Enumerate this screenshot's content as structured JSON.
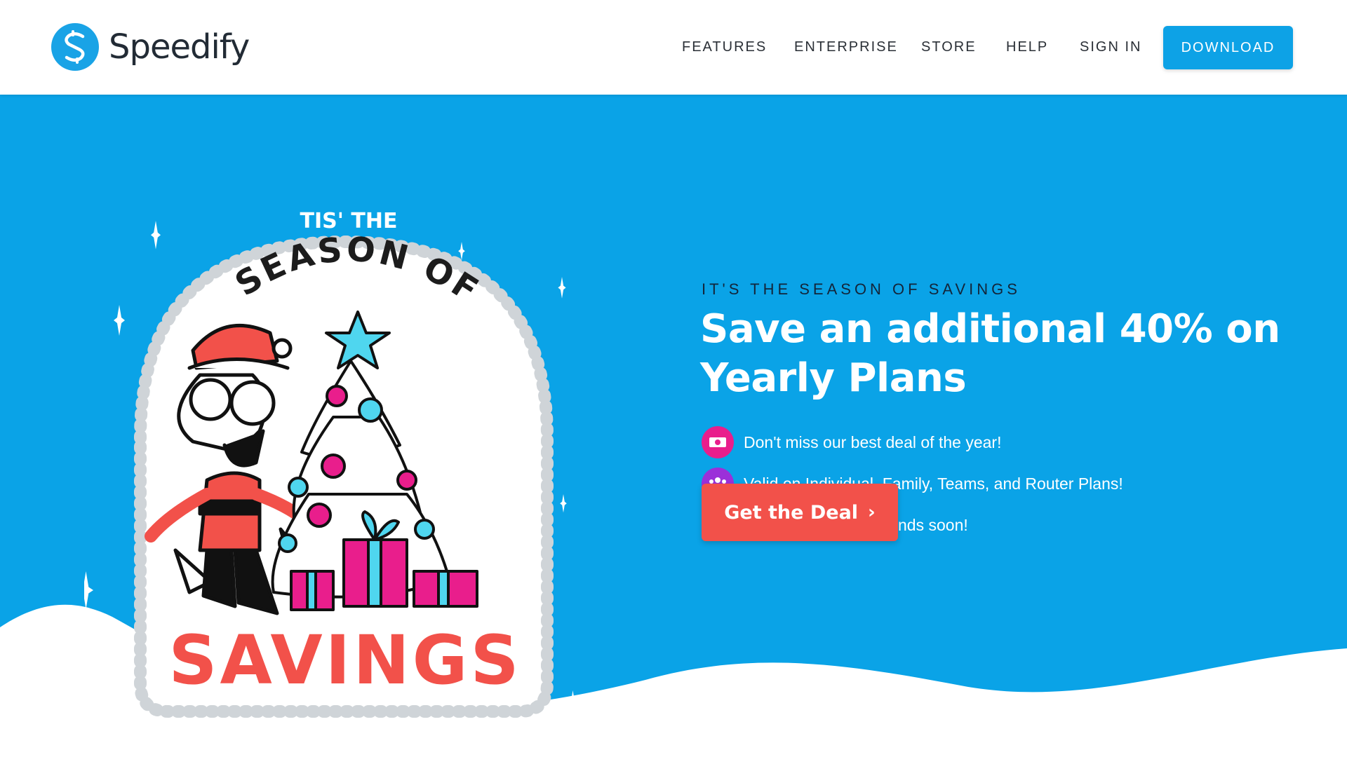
{
  "header": {
    "logo_text": "Speedify",
    "nav": [
      {
        "label": "FEATURES"
      },
      {
        "label": "ENTERPRISE"
      },
      {
        "label": "STORE"
      },
      {
        "label": "HELP"
      },
      {
        "label": "SIGN IN"
      }
    ],
    "download_label": "DOWNLOAD"
  },
  "hero": {
    "badge": {
      "top_text": "TIS' THE",
      "arc_text": "SEASON OF",
      "bottom_text": "SAVINGS"
    },
    "eyebrow": "IT'S THE SEASON OF SAVINGS",
    "headline": "Save an additional 40% on Yearly Plans",
    "features": [
      {
        "icon": "money-icon",
        "text": "Don't miss our best deal of the year!",
        "color": "#e91e8c"
      },
      {
        "icon": "users-icon",
        "text": "Valid on Individual, Family, Teams, and Router Plans!",
        "color": "#9b30d9"
      },
      {
        "icon": "alarm-clock-icon",
        "text": "Don't wait, this offer ends soon!",
        "color": "#6fdcf0"
      }
    ],
    "cta_label": "Get the Deal"
  },
  "colors": {
    "brand_blue": "#0aa3e7",
    "cta_red": "#f2514a",
    "white": "#ffffff"
  }
}
